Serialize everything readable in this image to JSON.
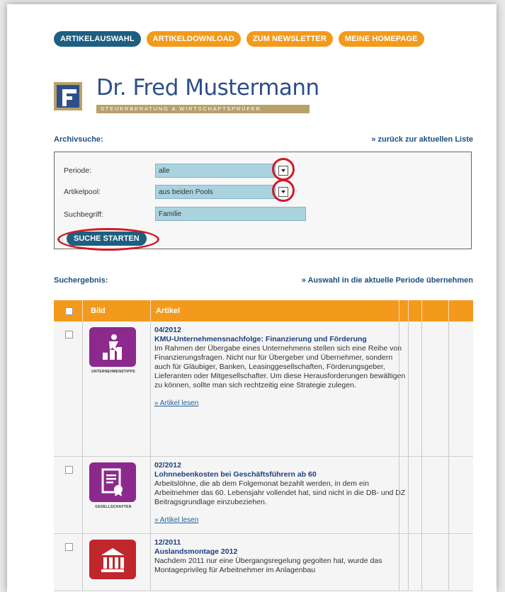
{
  "nav": {
    "tabs": [
      {
        "label": "ARTIKELAUSWAHL",
        "active": true
      },
      {
        "label": "ARTIKELDOWNLOAD",
        "active": false
      },
      {
        "label": "ZUM NEWSLETTER",
        "active": false
      },
      {
        "label": "MEINE HOMEPAGE",
        "active": false
      }
    ]
  },
  "logo": {
    "name": "Dr. Fred Mustermann",
    "subtitle": "STEUERBERATUNG & WIRTSCHAFTSPRÜFER"
  },
  "archive": {
    "heading": "Archivsuche:",
    "back_link": "» zurück zur aktuellen Liste",
    "periode_label": "Periode:",
    "periode_value": "alle",
    "pool_label": "Artikelpool:",
    "pool_value": "aus beiden Pools",
    "term_label": "Suchbegriff:",
    "term_value": "Familie",
    "start_button": "SUCHE STARTEN"
  },
  "results": {
    "heading": "Suchergebnis:",
    "apply_link": "» Auswahl in die aktuelle Periode übernehmen",
    "col_image": "Bild",
    "col_article": "Artikel",
    "rows": [
      {
        "date": "04/2012",
        "title": "KMU-Unternehmensnachfolge: Finanzierung und Förderung",
        "text": "Im Rahmen der Übergabe eines Unternehmens stellen sich eine Reihe von Finanzierungsfragen. Nicht nur für Übergeber und Übernehmer, sondern auch für Gläubiger, Banken, Leasinggesellschaften, Förderungsgeber, Lieferanten oder Mitgesellschafter. Um diese Herausforderungen bewältigen zu können, sollte man sich rechtzeitig eine Strategie zulegen.",
        "link": "» Artikel lesen",
        "category": "UNTERNEHMENSTIPPS",
        "icon": "growth-chart-icon",
        "color": "#8b2a8c"
      },
      {
        "date": "02/2012",
        "title": "Lohnnebenkosten bei Geschäftsführern ab 60",
        "text": "Arbeitslöhne, die ab dem Folgemonat bezahlt werden, in dem ein Arbeitnehmer das 60. Lebensjahr vollendet hat, sind nicht in die DB- und DZ Beitragsgrundlage einzubeziehen.",
        "link": "» Artikel lesen",
        "category": "GESELLSCHAFTEN",
        "icon": "certificate-icon",
        "color": "#8b2a8c"
      },
      {
        "date": "12/2011",
        "title": "Auslandsmontage 2012",
        "text": "Nachdem 2011 nur eine Übergangsregelung gegolten hat, wurde das Montageprivileg für Arbeitnehmer im Anlagenbau",
        "link": "",
        "category": "",
        "icon": "building-icon",
        "color": "#c0272d"
      }
    ]
  }
}
